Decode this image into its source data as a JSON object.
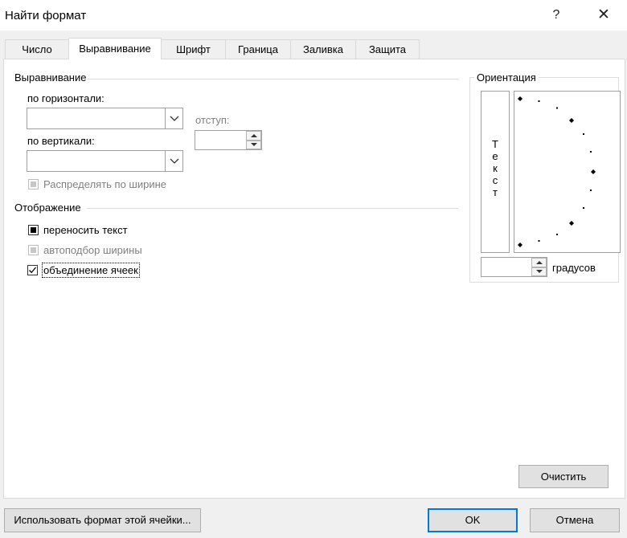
{
  "window": {
    "title": "Найти формат",
    "help_glyph": "?",
    "close_glyph": "✕"
  },
  "tabs": [
    {
      "label": "Число",
      "active": false
    },
    {
      "label": "Выравнивание",
      "active": true
    },
    {
      "label": "Шрифт",
      "active": false
    },
    {
      "label": "Граница",
      "active": false
    },
    {
      "label": "Заливка",
      "active": false
    },
    {
      "label": "Защита",
      "active": false
    }
  ],
  "alignment": {
    "group_label": "Выравнивание",
    "horizontal_label": "по горизонтали:",
    "horizontal_value": "",
    "vertical_label": "по вертикали:",
    "vertical_value": "",
    "indent_label": "отступ:",
    "indent_value": "",
    "justify_distributed_label": "Распределять по ширине"
  },
  "display": {
    "group_label": "Отображение",
    "wrap_text_label": "переносить текст",
    "shrink_to_fit_label": "автоподбор ширины",
    "merge_cells_label": "объединение ячеек"
  },
  "orientation": {
    "group_label": "Ориентация",
    "vertical_text": [
      "Т",
      "е",
      "к",
      "с",
      "т"
    ],
    "degrees_value": "",
    "degrees_label": "градусов"
  },
  "buttons": {
    "clear": "Очистить",
    "use_cell_format": "Использовать формат этой ячейки...",
    "ok": "OK",
    "cancel": "Отмена"
  },
  "icons": {
    "dropdown": "chevron-down-icon",
    "spin_up": "triangle-up-icon",
    "spin_down": "triangle-down-icon",
    "check": "checkmark-icon"
  },
  "colors": {
    "default_button_border": "#0078d7",
    "dialog_background": "#f0f0f0"
  }
}
